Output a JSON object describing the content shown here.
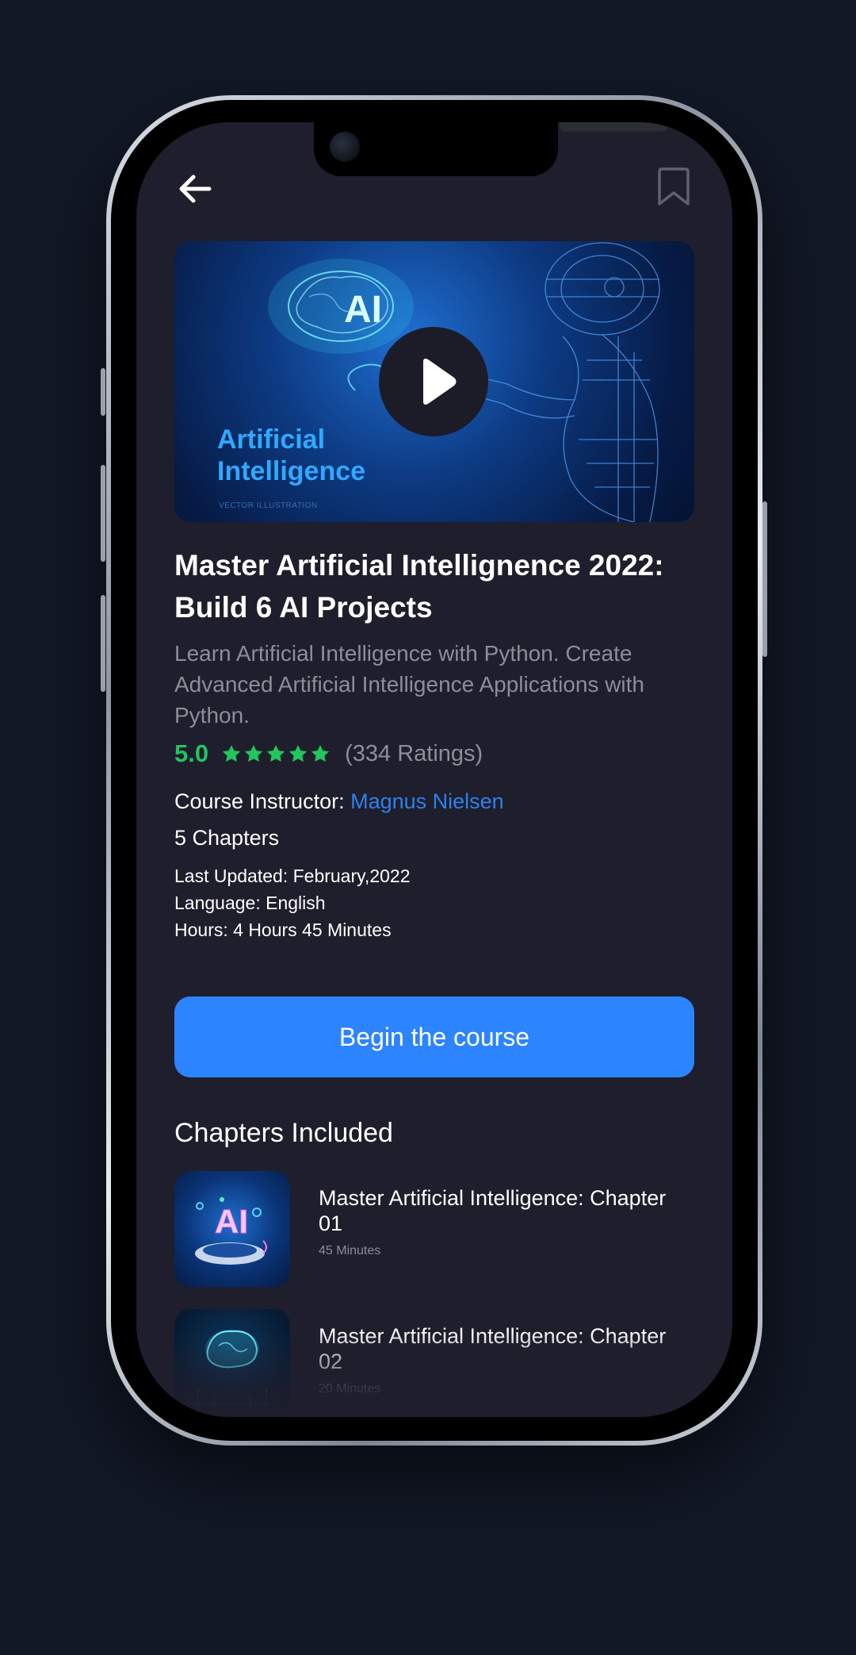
{
  "header": {
    "back_icon": "arrow-left-icon",
    "bookmark_icon": "bookmark-icon"
  },
  "video": {
    "thumbnail_title": "Artificial Intelligence",
    "thumbnail_caption": "VECTOR ILLUSTRATION",
    "thumbnail_badge": "AI",
    "play_icon": "play-icon"
  },
  "course": {
    "title": "Master Artificial Intellignence 2022: Build 6 AI Projects",
    "description": "Learn Artificial Intelligence with Python. Create Advanced Artificial Intelligence Applications with Python.",
    "rating_value": "5.0",
    "rating_stars": 5,
    "rating_count": "(334 Ratings)",
    "instructor_label": "Course Instructor:",
    "instructor_name": "Magnus Nielsen",
    "chapters_count": "5 Chapters",
    "last_updated": "Last Updated: February,2022",
    "language": "Language: English",
    "hours": "Hours: 4 Hours 45 Minutes"
  },
  "actions": {
    "begin_label": "Begin the course"
  },
  "chapters": {
    "section_title": "Chapters Included",
    "items": [
      {
        "title": "Master Artificial Intelligence: Chapter 01",
        "duration": "45 Minutes"
      },
      {
        "title": "Master Artificial Intelligence: Chapter 02",
        "duration": "20 Minutes"
      }
    ]
  },
  "colors": {
    "background": "#121826",
    "screen": "#1e1e2c",
    "accent": "#2d84ff",
    "rating_green": "#22c55e",
    "muted_text": "#8d8e9a",
    "link": "#2f80ed"
  }
}
